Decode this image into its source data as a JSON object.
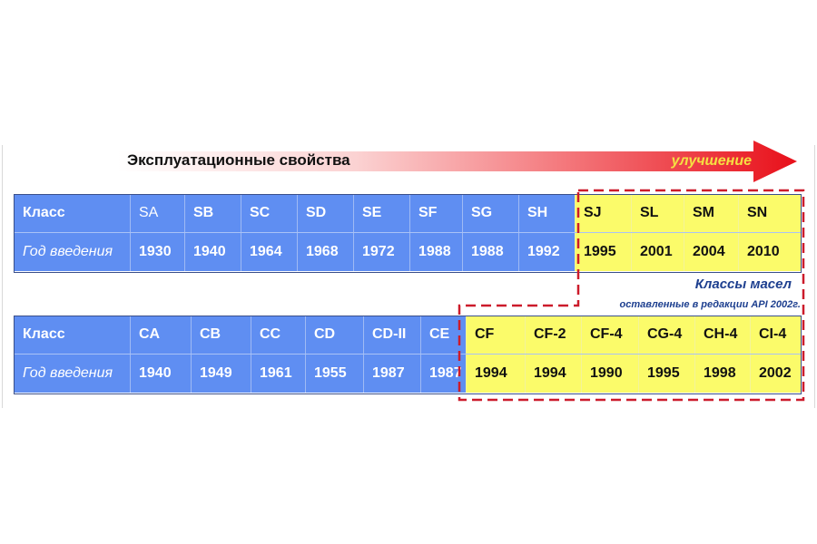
{
  "arrow": {
    "label": "Эксплуатационные свойства",
    "direction_label": "улучшение",
    "colors": {
      "start": "#ffffff",
      "end": "#e8101a",
      "direction_text": "#f5e042"
    }
  },
  "gasoline_table": {
    "row_labels": {
      "class": "Класс",
      "year": "Год введения"
    },
    "columns": [
      {
        "class": "SA",
        "year": "1930",
        "current": false
      },
      {
        "class": "SB",
        "year": "1940",
        "current": false
      },
      {
        "class": "SC",
        "year": "1964",
        "current": false
      },
      {
        "class": "SD",
        "year": "1968",
        "current": false
      },
      {
        "class": "SE",
        "year": "1972",
        "current": false
      },
      {
        "class": "SF",
        "year": "1988",
        "current": false
      },
      {
        "class": "SG",
        "year": "1988",
        "current": false
      },
      {
        "class": "SH",
        "year": "1992",
        "current": false
      },
      {
        "class": "SJ",
        "year": "1995",
        "current": true
      },
      {
        "class": "SL",
        "year": "2001",
        "current": true
      },
      {
        "class": "SM",
        "year": "2004",
        "current": true
      },
      {
        "class": "SN",
        "year": "2010",
        "current": true
      }
    ]
  },
  "diesel_table": {
    "row_labels": {
      "class": "Класс",
      "year": "Год введения"
    },
    "columns": [
      {
        "class": "CA",
        "year": "1940",
        "current": false
      },
      {
        "class": "CB",
        "year": "1949",
        "current": false
      },
      {
        "class": "CC",
        "year": "1961",
        "current": false
      },
      {
        "class": "CD",
        "year": "1955",
        "current": false
      },
      {
        "class": "CD-II",
        "year": "1987",
        "current": false
      },
      {
        "class": "CE",
        "year": "1987",
        "current": false
      },
      {
        "class": "CF",
        "year": "1994",
        "current": true
      },
      {
        "class": "CF-2",
        "year": "1994",
        "current": true
      },
      {
        "class": "CF-4",
        "year": "1990",
        "current": true
      },
      {
        "class": "CG-4",
        "year": "1995",
        "current": true
      },
      {
        "class": "CH-4",
        "year": "1998",
        "current": true
      },
      {
        "class": "CI-4",
        "year": "2002",
        "current": true
      }
    ]
  },
  "note": {
    "title": "Классы масел",
    "subtitle": "оставленные в редакции API 2002г."
  },
  "colors": {
    "obsolete_cell": "#5f8ef2",
    "current_cell": "#fbfb6a",
    "dashed_outline": "#cc1b2b",
    "note_text": "#1d3f8f"
  }
}
